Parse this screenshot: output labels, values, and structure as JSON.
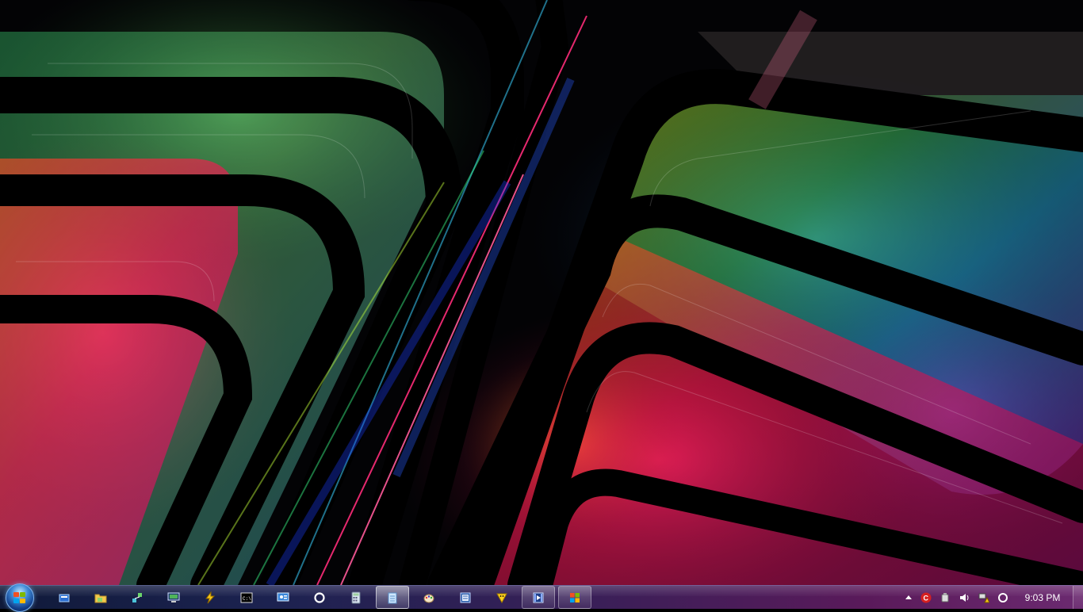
{
  "taskbar": {
    "start_button_icon": "windows-orb-icon",
    "pinned_items": [
      {
        "icon": "file-explorer-icon",
        "state": "normal"
      },
      {
        "icon": "folder-icon",
        "state": "normal"
      },
      {
        "icon": "network-settings-icon",
        "state": "normal"
      },
      {
        "icon": "remote-desktop-icon",
        "state": "normal"
      },
      {
        "icon": "lightning-tool-icon",
        "state": "normal"
      },
      {
        "icon": "command-prompt-icon",
        "state": "normal"
      },
      {
        "icon": "control-panel-icon",
        "state": "normal"
      },
      {
        "icon": "circle-app-icon",
        "state": "normal"
      },
      {
        "icon": "calculator-icon",
        "state": "normal"
      },
      {
        "icon": "notepad-icon",
        "state": "active"
      },
      {
        "icon": "paint-icon",
        "state": "normal"
      },
      {
        "icon": "document-editor-icon",
        "state": "normal"
      },
      {
        "icon": "smiley-app-icon",
        "state": "normal"
      },
      {
        "icon": "media-player-icon",
        "state": "running"
      },
      {
        "icon": "windows-logo-app-icon",
        "state": "running"
      }
    ],
    "tray": {
      "icons": [
        "show-hidden-icons-arrow",
        "c-security-icon",
        "usb-device-icon",
        "volume-icon",
        "network-warning-icon",
        "sync-circle-icon"
      ],
      "clock": "9:03 PM"
    }
  }
}
